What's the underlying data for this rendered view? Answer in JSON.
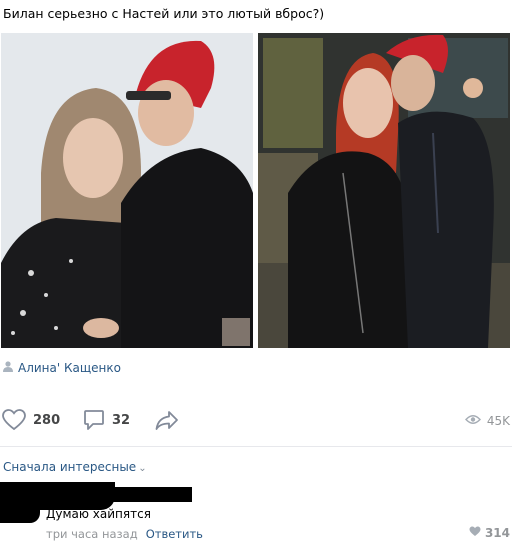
{
  "post": {
    "text": "Билан серьезно с Настей или это лютый вброс?)",
    "photos": [
      "photo-1",
      "photo-2"
    ],
    "author": "Алина' Кащенко"
  },
  "actions": {
    "likes": "280",
    "comments": "32",
    "views": "45K"
  },
  "comments_section": {
    "sort_label": "Сначала интересные",
    "comment": {
      "text": "Думаю хайпятся",
      "time": "три часа назад",
      "reply_label": "Ответить",
      "likes": "314"
    }
  },
  "colors": {
    "link": "#2a5885",
    "meta": "#939699",
    "divider": "#e7e8ec",
    "hair_red": "#c8232c"
  }
}
